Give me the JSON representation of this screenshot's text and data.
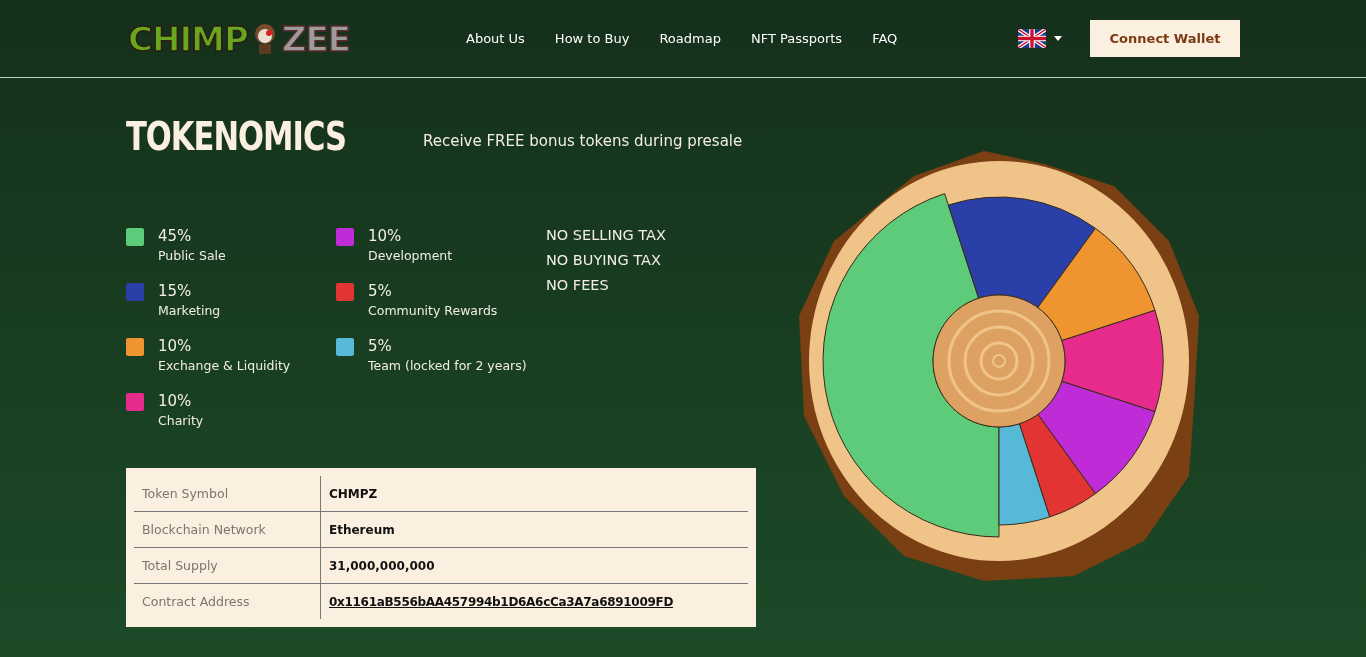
{
  "header": {
    "logo": {
      "left": "CHIMP",
      "right": "ZEE"
    },
    "nav": [
      "About Us",
      "How to Buy",
      "Roadmap",
      "NFT Passports",
      "FAQ"
    ],
    "connect_button": "Connect Wallet"
  },
  "tokenomics": {
    "title": "TOKENOMICS",
    "subtitle": "Receive FREE bonus tokens during presale",
    "allocations": [
      {
        "percent": "45%",
        "label": "Public Sale",
        "color": "#5dcb7a"
      },
      {
        "percent": "15%",
        "label": "Marketing",
        "color": "#2b3fa8"
      },
      {
        "percent": "10%",
        "label": "Exchange & Liquidity",
        "color": "#ef9530"
      },
      {
        "percent": "10%",
        "label": "Charity",
        "color": "#e62b8c"
      },
      {
        "percent": "10%",
        "label": "Development",
        "color": "#bf2bd6"
      },
      {
        "percent": "5%",
        "label": "Community Rewards",
        "color": "#e33434"
      },
      {
        "percent": "5%",
        "label": "Team (locked for 2 years)",
        "color": "#56b9d8"
      }
    ],
    "tax_notes": [
      "NO SELLING TAX",
      "NO BUYING TAX",
      "NO FEES"
    ],
    "token_table": [
      {
        "label": "Token Symbol",
        "value": "CHMPZ",
        "kind": "text"
      },
      {
        "label": "Blockchain Network",
        "value": "Ethereum",
        "kind": "text"
      },
      {
        "label": "Total Supply",
        "value": "31,000,000,000",
        "kind": "text"
      },
      {
        "label": "Contract Address",
        "value": "0x1161aB556bAA457994b1D6A6cCa3A7a6891009FD",
        "kind": "link"
      }
    ],
    "chart_data": {
      "type": "donut",
      "values": [
        45,
        15,
        10,
        10,
        10,
        5,
        5
      ]
    }
  }
}
